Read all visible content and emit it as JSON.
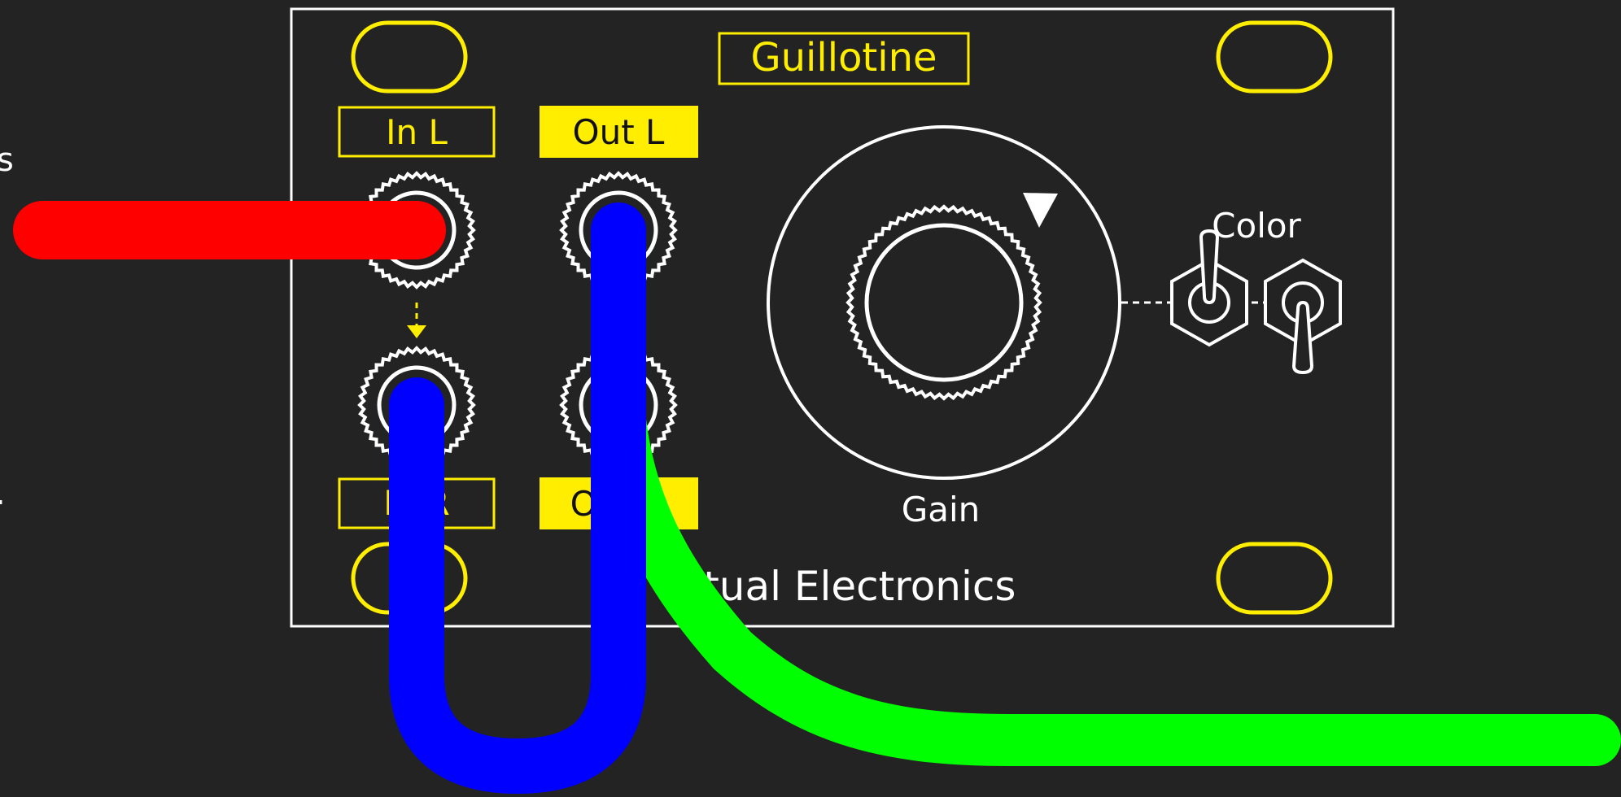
{
  "colors": {
    "background": "#232323",
    "panel_outline": "#ffffff",
    "accent": "#ffee00",
    "foreground": "#ffffff",
    "cable_red": "#ff0000",
    "cable_blue": "#0000ff",
    "cable_green": "#00ff00"
  },
  "module": {
    "title": "Guillotine",
    "brand": "Ritual Electronics"
  },
  "jacks": {
    "in_l": "In L",
    "out_l": "Out L",
    "in_r": "In R",
    "out_r": "Out R"
  },
  "controls": {
    "gain_label": "Gain",
    "color_label": "Color"
  },
  "icons": {
    "mounting_hole": "rounded-rect-outline",
    "jack": "knurled-circle",
    "knob": "knurled-knob",
    "toggle": "hex-toggle-switch"
  },
  "offscreen_labels": {
    "left_top_fragment": "s",
    "left_mid_fragment": "."
  }
}
